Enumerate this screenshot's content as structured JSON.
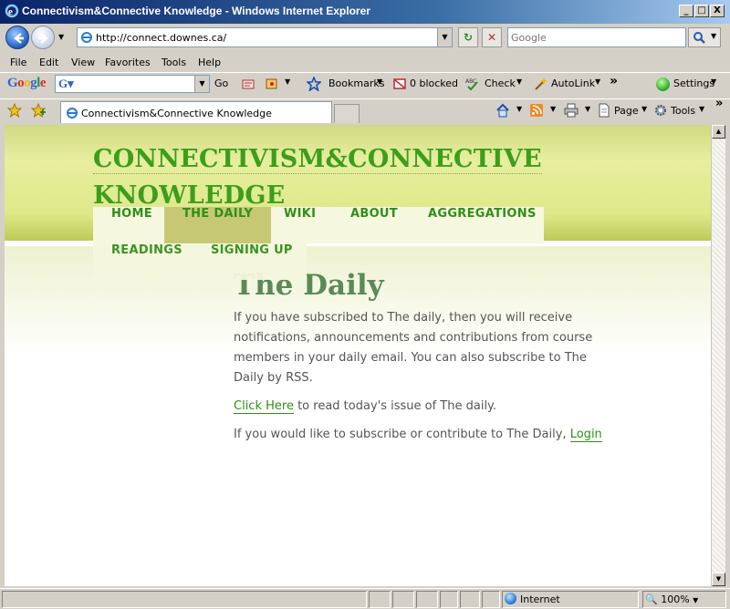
{
  "window": {
    "title": "Connectivism&Connective Knowledge - Windows Internet Explorer",
    "min": "_",
    "max": "□",
    "close": "X"
  },
  "address": {
    "url": "http://connect.downes.ca/"
  },
  "search": {
    "placeholder": "Google"
  },
  "menu": [
    "File",
    "Edit",
    "View",
    "Favorites",
    "Tools",
    "Help"
  ],
  "google_toolbar": {
    "logo": "Google",
    "go": "Go",
    "bookmarks": "Bookmarks",
    "blocked": "0 blocked",
    "check": "Check",
    "autolink": "AutoLink",
    "more": "»",
    "settings": "Settings"
  },
  "tab": {
    "title": "Connectivism&Connective Knowledge"
  },
  "command_bar": {
    "page": "Page",
    "tools": "Tools",
    "more": "»"
  },
  "site": {
    "title_line1": "CONNECTIVISM&CONNECTIVE",
    "title_line2": "KNOWLEDGE",
    "nav": [
      "HOME",
      "THE DAILY",
      "WIKI",
      "ABOUT",
      "AGGREGATIONS",
      "READINGS",
      "SIGNING UP"
    ]
  },
  "content": {
    "heading": "The Daily",
    "para1": "If you have subscribed to The daily, then you will receive notifications, announcements and contributions from course members in your daily email. You can also subscribe to The Daily by RSS.",
    "click_here": "Click Here",
    "para2_rest": " to read today's issue of The daily.",
    "para3_text": "If you would like to subscribe or contribute to The Daily, ",
    "login": "Login"
  },
  "status": {
    "zone": "Internet",
    "zoom": "100%"
  },
  "colors": {
    "accent_green": "#2f8f17",
    "header_green": "#dfe88a",
    "heading_green": "#5a8a57"
  }
}
